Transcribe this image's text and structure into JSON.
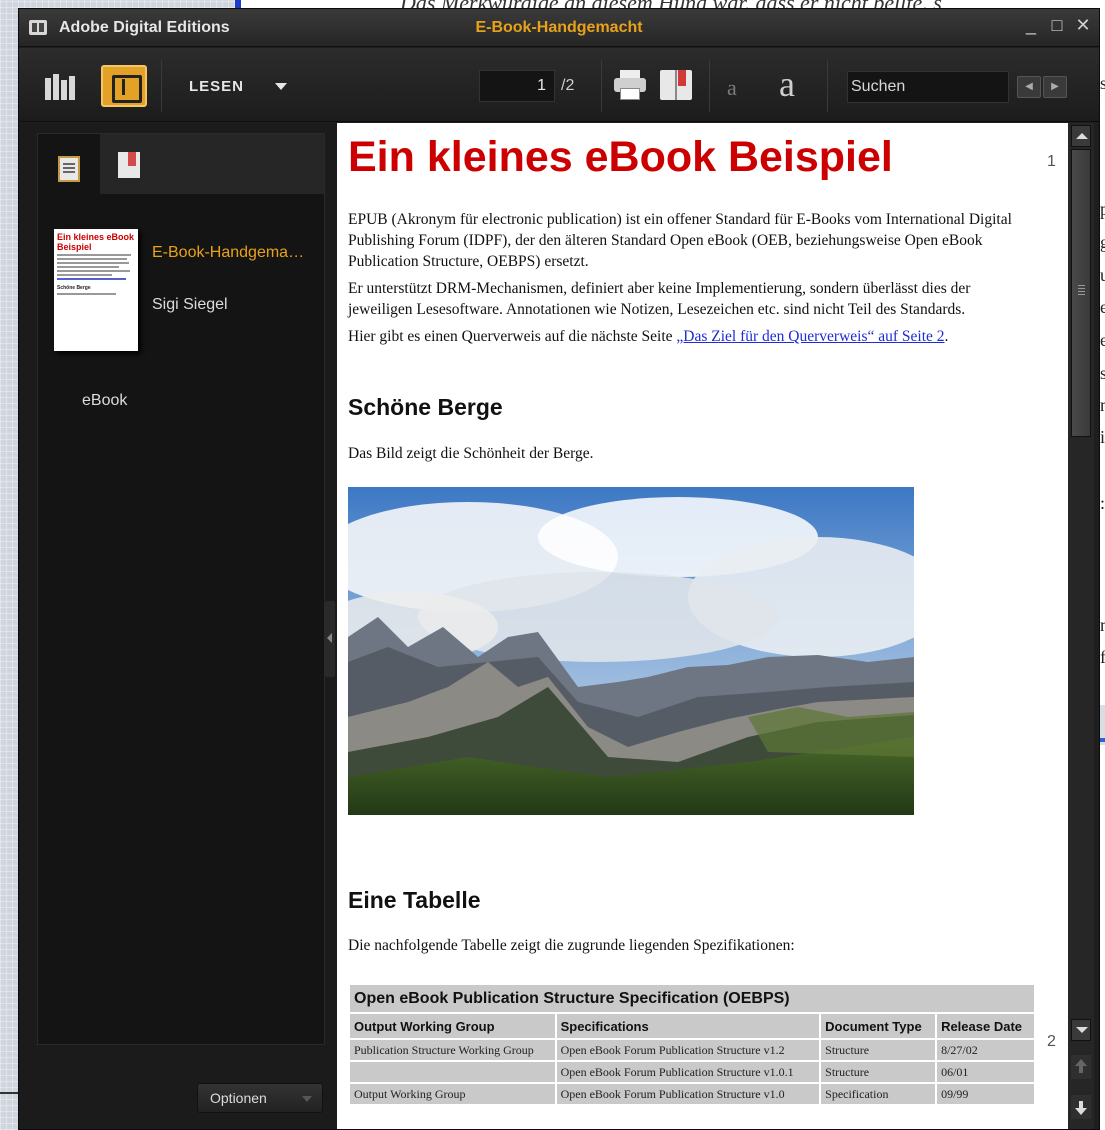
{
  "window": {
    "app_title": "Adobe Digital Editions",
    "doc_title": "E-Book-Handgemacht",
    "minimize": "_",
    "maximize": "□",
    "close": "✕"
  },
  "background": {
    "top_text": "Das Merkwürdige an diesem Hund war, dass er nicht bellte, s",
    "edge_chars": [
      "s",
      "p",
      "g",
      "u",
      "e",
      "e",
      "s",
      "n",
      "i",
      ":",
      "n",
      "f"
    ]
  },
  "toolbar": {
    "view_mode_label": "LESEN",
    "current_page": "1",
    "page_total": "/2",
    "font_decrease": "a",
    "font_increase": "a",
    "search_placeholder": "Suchen",
    "search_prev": "◀",
    "search_next": "▶"
  },
  "sidebar": {
    "book_title": "E-Book-Handgema…",
    "author": "Sigi Siegel",
    "type": "eBook",
    "thumbnail_title": "Ein kleines eBook Beispiel",
    "thumbnail_heading": "Schöne Berge",
    "options_label": "Optionen"
  },
  "content": {
    "title": "Ein kleines eBook Beispiel",
    "page_number_1": "1",
    "page_number_2": "2",
    "para1": "EPUB (Akronym für electronic publication) ist ein offener Standard für E-Books vom International Digital Publishing Forum (IDPF), der den älteren Standard Open eBook (OEB, beziehungsweise Open eBook Publication Structure, OEBPS) ersetzt.",
    "para2": "Er unterstützt DRM-Mechanismen, definiert aber keine Implementierung, sondern überlässt dies der jeweiligen Lesesoftware. Annotationen wie Notizen, Lesezeichen etc. sind nicht Teil des Standards.",
    "para3_prefix": "Hier gibt es einen Querverweis auf die nächste Seite ",
    "para3_link": "„Das Ziel für den Querverweis“ auf Seite 2",
    "para3_suffix": ".",
    "section1_heading": "Schöne Berge",
    "section1_text": "Das Bild zeigt die Schönheit der Berge.",
    "section2_heading": "Eine Tabelle",
    "section2_text": "Die nachfolgende Tabelle zeigt die zugrunde liegenden Spezifikationen:",
    "table": {
      "caption": "Open eBook Publication Structure Specification (OEBPS)",
      "headers": [
        "Output Working Group",
        "Specifications",
        "Document Type",
        "Release Date"
      ],
      "rows": [
        [
          "Publication Structure Working Group",
          "Open eBook Forum Publication Structure v1.2",
          "Structure",
          "8/27/02"
        ],
        [
          "",
          "Open eBook Forum Publication Structure v1.0.1",
          "Structure",
          "06/01"
        ],
        [
          "Output Working Group",
          "Open eBook Forum Publication Structure v1.0",
          "Specification",
          "09/99"
        ]
      ]
    }
  },
  "colors": {
    "accent": "#e8a21a",
    "heading_red": "#cc0000",
    "link_blue": "#1f2bd6"
  }
}
